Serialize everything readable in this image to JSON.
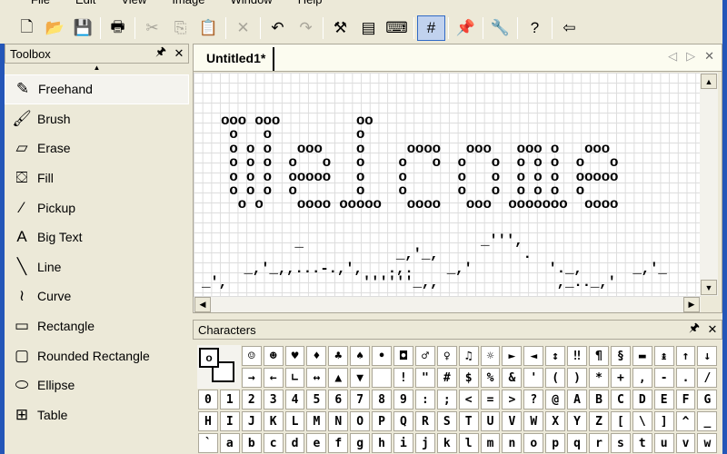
{
  "menu": [
    "File",
    "Edit",
    "View",
    "Image",
    "Window",
    "Help"
  ],
  "toolbar": [
    {
      "icon": "new-icon",
      "g": "🗋"
    },
    {
      "icon": "open-icon",
      "g": "📂"
    },
    {
      "icon": "save-icon",
      "g": "💾"
    },
    {
      "sep": true
    },
    {
      "icon": "print-icon",
      "g": "🖶"
    },
    {
      "sep": true
    },
    {
      "icon": "cut-icon",
      "g": "✂",
      "dis": true
    },
    {
      "icon": "copy-icon",
      "g": "⎘",
      "dis": true
    },
    {
      "icon": "paste-icon",
      "g": "📋",
      "dis": true
    },
    {
      "sep": true
    },
    {
      "icon": "delete-icon",
      "g": "✕",
      "dis": true
    },
    {
      "sep": true
    },
    {
      "icon": "undo-icon",
      "g": "↶"
    },
    {
      "icon": "redo-icon",
      "g": "↷",
      "dis": true
    },
    {
      "sep": true
    },
    {
      "icon": "tools-icon",
      "g": "⚒"
    },
    {
      "icon": "properties-icon",
      "g": "▤"
    },
    {
      "icon": "keyboard-icon",
      "g": "⌨"
    },
    {
      "sep": true
    },
    {
      "icon": "grid-icon",
      "g": "#",
      "on": true
    },
    {
      "sep": true
    },
    {
      "icon": "pin-icon",
      "g": "📌"
    },
    {
      "sep": true
    },
    {
      "icon": "wrench-icon",
      "g": "🔧"
    },
    {
      "sep": true
    },
    {
      "icon": "help-icon",
      "g": "?"
    },
    {
      "sep": true
    },
    {
      "icon": "exit-icon",
      "g": "⇦"
    }
  ],
  "toolbox": {
    "title": "Toolbox",
    "pin": "🖈",
    "close": "✕",
    "scroll_up": "▲",
    "tools": [
      {
        "label": "Freehand",
        "icon": "pencil-icon",
        "g": "✎"
      },
      {
        "label": "Brush",
        "icon": "brush-icon",
        "g": "🖌"
      },
      {
        "label": "Erase",
        "icon": "eraser-icon",
        "g": "▱"
      },
      {
        "label": "Fill",
        "icon": "fill-bucket-icon",
        "g": "⛋"
      },
      {
        "label": "Pickup",
        "icon": "eyedropper-icon",
        "g": "⁄"
      },
      {
        "label": "Big Text",
        "icon": "big-text-icon",
        "g": "A"
      },
      {
        "label": "Line",
        "icon": "line-icon",
        "g": "╲"
      },
      {
        "label": "Curve",
        "icon": "curve-icon",
        "g": "≀"
      },
      {
        "label": "Rectangle",
        "icon": "rectangle-icon",
        "g": "▭"
      },
      {
        "label": "Rounded Rectangle",
        "icon": "rounded-rectangle-icon",
        "g": "▢"
      },
      {
        "label": "Ellipse",
        "icon": "ellipse-icon",
        "g": "⬭"
      },
      {
        "label": "Table",
        "icon": "table-icon",
        "g": "⊞"
      }
    ]
  },
  "document": {
    "tab": "Untitled1*",
    "prev": "◁",
    "next": "▷",
    "close": "✕",
    "art": "ooo ooo         oo\n o   o          o\n o o o   ooo    o     oooo   ooo   ooo o   ooo\n o o o  o   o   o    o   o  o   o  o o o  o   o\n o o o  ooooo   o    o      o   o  o o o  ooooo\n o o o  o       o    o      o   o  o o o  o\n  o o    oooo ooooo   oooo   ooo  ooooooo  oooo",
    "wave": "                                 _''',\n           ¯           _,'_,          .\n     _,'_,,...-.,',   .,.    _,'         '._,      _,'_\n_',                ''''''_,,              ,_.._,'"
  },
  "characters": {
    "title": "Characters",
    "pin": "🖈",
    "close": "✕",
    "fg": "o",
    "rows": [
      [
        "☺",
        "☻",
        "♥",
        "♦",
        "♣",
        "♠",
        "•",
        "◘",
        "♂",
        "♀",
        "♫",
        "☼",
        "►",
        "◄",
        "↕",
        "‼",
        "¶",
        "§",
        "▬",
        "↨",
        "↑",
        "↓"
      ],
      [
        "→",
        "←",
        "∟",
        "↔",
        "▲",
        "▼",
        " ",
        "!",
        "\"",
        "#",
        "$",
        "%",
        "&",
        "'",
        "(",
        ")",
        "*",
        "+",
        ",",
        "-",
        ".",
        "/"
      ],
      [
        "0",
        "1",
        "2",
        "3",
        "4",
        "5",
        "6",
        "7",
        "8",
        "9",
        ":",
        ";",
        "<",
        "=",
        ">",
        "?",
        "@",
        "A",
        "B",
        "C",
        "D",
        "E",
        "F",
        "G"
      ],
      [
        "H",
        "I",
        "J",
        "K",
        "L",
        "M",
        "N",
        "O",
        "P",
        "Q",
        "R",
        "S",
        "T",
        "U",
        "V",
        "W",
        "X",
        "Y",
        "Z",
        "[",
        "\\",
        "]",
        "^",
        "_"
      ],
      [
        "`",
        "a",
        "b",
        "c",
        "d",
        "e",
        "f",
        "g",
        "h",
        "i",
        "j",
        "k",
        "l",
        "m",
        "n",
        "o",
        "p",
        "q",
        "r",
        "s",
        "t",
        "u",
        "v",
        "w"
      ]
    ]
  }
}
